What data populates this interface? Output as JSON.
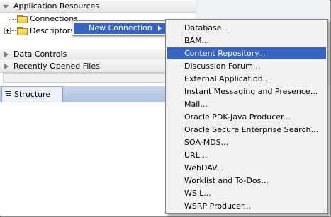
{
  "panel": {
    "application_resources": "Application Resources",
    "connections": "Connections",
    "descriptors": "Descriptors",
    "data_controls": "Data Controls",
    "recently_opened": "Recently Opened Files",
    "structure_tab": "Structure"
  },
  "context_menu": {
    "new_connection": "New Connection"
  },
  "submenu": {
    "items": [
      {
        "label": "Database..."
      },
      {
        "label": "BAM..."
      },
      {
        "label": "Content Repository..."
      },
      {
        "label": "Discussion Forum..."
      },
      {
        "label": "External Application..."
      },
      {
        "label": "Instant Messaging and Presence..."
      },
      {
        "label": "Mail..."
      },
      {
        "label": "Oracle PDK-Java Producer..."
      },
      {
        "label": "Oracle Secure Enterprise Search..."
      },
      {
        "label": "SOA-MDS..."
      },
      {
        "label": "URL..."
      },
      {
        "label": "WebDAV..."
      },
      {
        "label": "Worklist and To-Dos..."
      },
      {
        "label": "WSIL..."
      },
      {
        "label": "WSRP Producer..."
      }
    ],
    "selected": "Content Repository..."
  },
  "colors": {
    "selection": "#3863bf",
    "menu_bg": "#f2f2f2",
    "tab_bar": "#aec2df"
  }
}
